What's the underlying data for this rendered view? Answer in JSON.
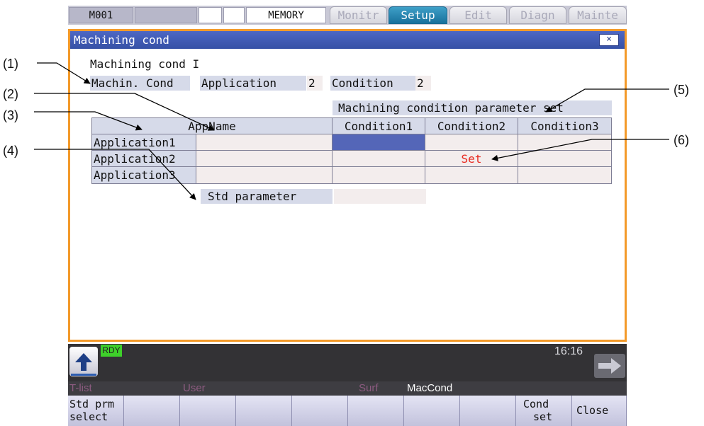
{
  "topbar": {
    "mode": "M001",
    "memory": "MEMORY",
    "tabs": [
      {
        "label": "Monitr",
        "active": false
      },
      {
        "label": "Setup",
        "active": true
      },
      {
        "label": "Edit",
        "active": false
      },
      {
        "label": "Diagn",
        "active": false
      },
      {
        "label": "Mainte",
        "active": false
      }
    ]
  },
  "window": {
    "title": "Machining cond",
    "close_label": "×",
    "heading": "Machining cond I",
    "machin_cond_label": "Machin. Cond",
    "application_label": "Application",
    "application_value": "2",
    "condition_label": "Condition",
    "condition_value": "2",
    "param_set_header": "Machining condition parameter set",
    "columns": [
      "AppName",
      "Condition1",
      "Condition2",
      "Condition3"
    ],
    "rows": [
      {
        "name": "Application1",
        "appname": "",
        "cells": [
          "",
          "",
          ""
        ]
      },
      {
        "name": "Application2",
        "appname": "",
        "cells": [
          "",
          "Set",
          ""
        ]
      },
      {
        "name": "Application3",
        "appname": "",
        "cells": [
          "",
          "",
          ""
        ]
      }
    ],
    "selected_cell": {
      "row": 1,
      "col": 1
    },
    "std_parameter_label": "Std parameter",
    "std_parameter_value": ""
  },
  "callouts": [
    "(1)",
    "(2)",
    "(3)",
    "(4)",
    "(5)",
    "(6)"
  ],
  "status": {
    "ready": "RDY",
    "clock": "16:16"
  },
  "menu": [
    {
      "label": "T-list",
      "active": false
    },
    {
      "label": "User",
      "active": false
    },
    {
      "label": "Surf",
      "active": false
    },
    {
      "label": "MacCond",
      "active": true
    }
  ],
  "softkeys": [
    {
      "line1": "Std prm",
      "line2": "select"
    },
    {
      "line1": "",
      "line2": ""
    },
    {
      "line1": "",
      "line2": ""
    },
    {
      "line1": "",
      "line2": ""
    },
    {
      "line1": "",
      "line2": ""
    },
    {
      "line1": "",
      "line2": ""
    },
    {
      "line1": "",
      "line2": ""
    },
    {
      "line1": "",
      "line2": ""
    },
    {
      "line1": "Cond",
      "line2": "set"
    },
    {
      "line1": "Close",
      "line2": ""
    }
  ],
  "colors": {
    "accent_orange": "#f39a2a",
    "title_blue": "#3651a6",
    "selected_cell": "#5466b8",
    "set_text": "#e8291f",
    "ready_green": "#3ed02a"
  }
}
